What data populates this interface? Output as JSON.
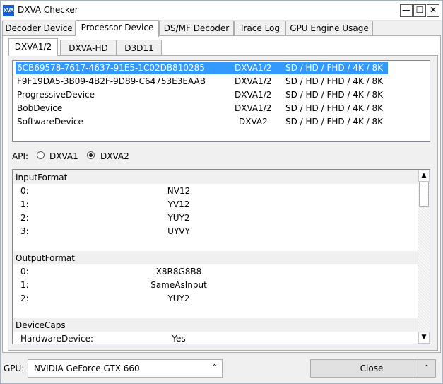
{
  "window": {
    "title": "DXVA Checker",
    "icon_text": "XVA",
    "min_glyph": "—",
    "max_glyph": "☐",
    "close_glyph": "✕"
  },
  "main_tabs": [
    {
      "label": "Decoder Device",
      "active": false
    },
    {
      "label": "Processor Device",
      "active": true
    },
    {
      "label": "DS/MF Decoder",
      "active": false
    },
    {
      "label": "Trace Log",
      "active": false
    },
    {
      "label": "GPU Engine Usage",
      "active": false
    }
  ],
  "sub_tabs": [
    {
      "label": "DXVA1/2",
      "active": true
    },
    {
      "label": "DXVA-HD",
      "active": false
    },
    {
      "label": "D3D11",
      "active": false
    }
  ],
  "devices": [
    {
      "name": "6CB69578-7617-4637-91E5-1C02DB810285",
      "api": "DXVA1/2",
      "resolutions": "SD / HD / FHD / 4K / 8K",
      "selected": true
    },
    {
      "name": "F9F19DA5-3B09-4B2F-9D89-C64753E3EAAB",
      "api": "DXVA1/2",
      "resolutions": "SD / HD / FHD / 4K / 8K",
      "selected": false
    },
    {
      "name": "ProgressiveDevice",
      "api": "DXVA1/2",
      "resolutions": "SD / HD / FHD / 4K / 8K",
      "selected": false
    },
    {
      "name": "BobDevice",
      "api": "DXVA1/2",
      "resolutions": "SD / HD / FHD / 4K / 8K",
      "selected": false
    },
    {
      "name": "SoftwareDevice",
      "api": "DXVA2",
      "resolutions": "SD / HD / FHD / 4K / 8K",
      "selected": false
    }
  ],
  "api_selector": {
    "label": "API:",
    "options": [
      {
        "label": "DXVA1",
        "checked": false
      },
      {
        "label": "DXVA2",
        "checked": true
      }
    ]
  },
  "properties": {
    "input_format": {
      "header": "InputFormat",
      "rows": [
        {
          "key": "0:",
          "value": "NV12"
        },
        {
          "key": "1:",
          "value": "YV12"
        },
        {
          "key": "2:",
          "value": "YUY2"
        },
        {
          "key": "3:",
          "value": "UYVY"
        }
      ]
    },
    "output_format": {
      "header": "OutputFormat",
      "rows": [
        {
          "key": "0:",
          "value": "X8R8G8B8"
        },
        {
          "key": "1:",
          "value": "SameAsInput"
        },
        {
          "key": "2:",
          "value": "YUY2"
        }
      ]
    },
    "device_caps": {
      "header": "DeviceCaps",
      "rows": [
        {
          "key": "HardwareDevice:",
          "value": "Yes"
        }
      ]
    }
  },
  "scroll": {
    "up_glyph": "▲",
    "down_glyph": "▼"
  },
  "footer": {
    "gpu_label": "GPU:",
    "gpu_value": "NVIDIA GeForce GTX 660",
    "gpu_arrow": "⌃",
    "close_label": "Close",
    "collapse_glyph": "⌃"
  },
  "colors": {
    "selection": "#3399ff",
    "panel_bg": "#f0f0f0"
  }
}
